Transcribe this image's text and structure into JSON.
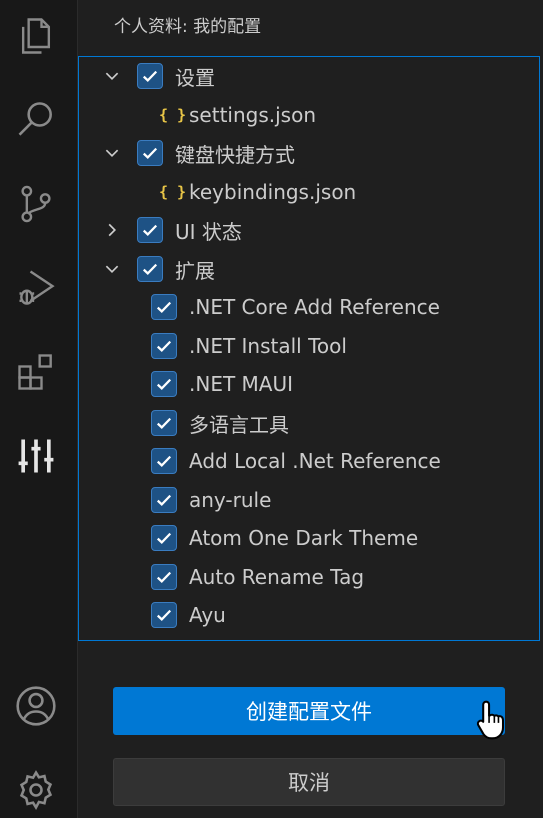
{
  "activity_bar": {
    "items": [
      {
        "name": "explorer-icon"
      },
      {
        "name": "search-icon"
      },
      {
        "name": "source-control-icon"
      },
      {
        "name": "run-debug-icon"
      },
      {
        "name": "extensions-icon"
      },
      {
        "name": "settings-sliders-icon"
      }
    ],
    "bottom": [
      {
        "name": "account-icon"
      },
      {
        "name": "gear-icon"
      }
    ]
  },
  "panel": {
    "title": "个人资料: 我的配置"
  },
  "tree": {
    "settings": {
      "label": "设置",
      "expanded": true,
      "checked": true
    },
    "settings_json": {
      "icon": "{ }",
      "label": "settings.json"
    },
    "keybindings": {
      "label": "键盘快捷方式",
      "expanded": true,
      "checked": true
    },
    "keybindings_json": {
      "icon": "{ }",
      "label": "keybindings.json"
    },
    "ui_state": {
      "label": "UI 状态",
      "expanded": false,
      "checked": true
    },
    "extensions": {
      "label": "扩展",
      "expanded": true,
      "checked": true
    },
    "extension_items": [
      ".NET Core Add Reference",
      ".NET Install Tool",
      ".NET MAUI",
      "多语言工具",
      "Add Local .Net Reference",
      "any-rule",
      "Atom One Dark Theme",
      "Auto Rename Tag",
      "Ayu"
    ]
  },
  "buttons": {
    "create": "创建配置文件",
    "cancel": "取消"
  },
  "colors": {
    "accent": "#0078d4",
    "checkbox": "#1e5285",
    "json_icon": "#e8c547"
  }
}
